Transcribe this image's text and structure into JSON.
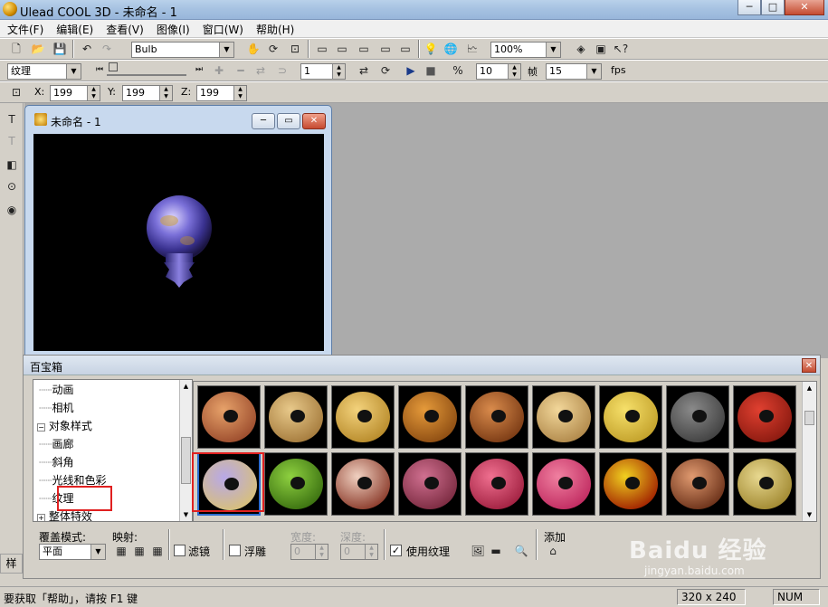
{
  "window": {
    "title": "Ulead COOL 3D - 未命名 - 1",
    "min_label": "─",
    "max_label": "□",
    "close_label": "✕"
  },
  "menu": [
    "文件(F)",
    "编辑(E)",
    "查看(V)",
    "图像(I)",
    "窗口(W)",
    "帮助(H)"
  ],
  "toolbar1": {
    "object_combo": "Bulb",
    "zoom_combo": "100%"
  },
  "toolbar2": {
    "attribute_combo": "纹理",
    "frame_value": "1",
    "frames_total_value": "10",
    "frame_label": "帧",
    "fps_value": "15",
    "fps_label": "fps"
  },
  "toolbar3": {
    "x_label": "X:",
    "x_value": "199",
    "y_label": "Y:",
    "y_value": "199",
    "z_label": "Z:",
    "z_value": "199"
  },
  "document": {
    "title": "未命名 - 1"
  },
  "gallery": {
    "title": "百宝箱",
    "tree": [
      {
        "label": "动画",
        "indent": 2
      },
      {
        "label": "相机",
        "indent": 2
      },
      {
        "label": "对象样式",
        "indent": 1,
        "expander": "−"
      },
      {
        "label": "画廊",
        "indent": 2
      },
      {
        "label": "斜角",
        "indent": 2
      },
      {
        "label": "光线和色彩",
        "indent": 2
      },
      {
        "label": "纹理",
        "indent": 2,
        "selected": true
      },
      {
        "label": "整体特效",
        "indent": 1,
        "expander": "+"
      }
    ],
    "thumbnails": [
      {
        "name": "texture-1",
        "color1": "#e7a26a",
        "color2": "#9b4b2c"
      },
      {
        "name": "texture-2",
        "color1": "#e8c98a",
        "color2": "#a47a3c"
      },
      {
        "name": "texture-3",
        "color1": "#f3d27c",
        "color2": "#b78a2a"
      },
      {
        "name": "texture-4",
        "color1": "#e59a3a",
        "color2": "#8c4c12"
      },
      {
        "name": "texture-5",
        "color1": "#d98b4c",
        "color2": "#7a3a14"
      },
      {
        "name": "texture-6",
        "color1": "#f2d79a",
        "color2": "#b0884a"
      },
      {
        "name": "texture-7",
        "color1": "#f6e06a",
        "color2": "#c2a02a"
      },
      {
        "name": "texture-8",
        "color1": "#8a8a8a",
        "color2": "#404040"
      },
      {
        "name": "texture-9",
        "color1": "#e04030",
        "color2": "#8a1a10"
      },
      {
        "name": "texture-10",
        "color1": "#b8a8e8",
        "color2": "#d8c078",
        "selected": true
      },
      {
        "name": "texture-11",
        "color1": "#8ed040",
        "color2": "#3a7010"
      },
      {
        "name": "texture-12",
        "color1": "#f0d0c0",
        "color2": "#8a3a2a"
      },
      {
        "name": "texture-13",
        "color1": "#d07090",
        "color2": "#7a2a40"
      },
      {
        "name": "texture-14",
        "color1": "#f07090",
        "color2": "#a02040"
      },
      {
        "name": "texture-15",
        "color1": "#f080a0",
        "color2": "#c02a60"
      },
      {
        "name": "texture-16",
        "color1": "#f0d020",
        "color2": "#a02000"
      },
      {
        "name": "texture-17",
        "color1": "#e09a70",
        "color2": "#6a3018"
      },
      {
        "name": "texture-18",
        "color1": "#e8d890",
        "color2": "#a08830"
      }
    ]
  },
  "gallery_footer": {
    "overlay_label": "覆盖模式:",
    "overlay_value": "平面",
    "mapping_label": "映射:",
    "filter_label": "滤镜",
    "emboss_label": "浮雕",
    "width_label": "宽度:",
    "width_value": "0",
    "depth_label": "深度:",
    "depth_value": "0",
    "use_texture_label": "使用纹理",
    "add_label": "添加",
    "side_tab_label": "样"
  },
  "status": {
    "help_text": "要获取「帮助」，请按 F1 键",
    "size": "320 x 240",
    "num": "NUM"
  },
  "watermark": {
    "text": "Baidu 经验",
    "url": "jingyan.baidu.com"
  }
}
